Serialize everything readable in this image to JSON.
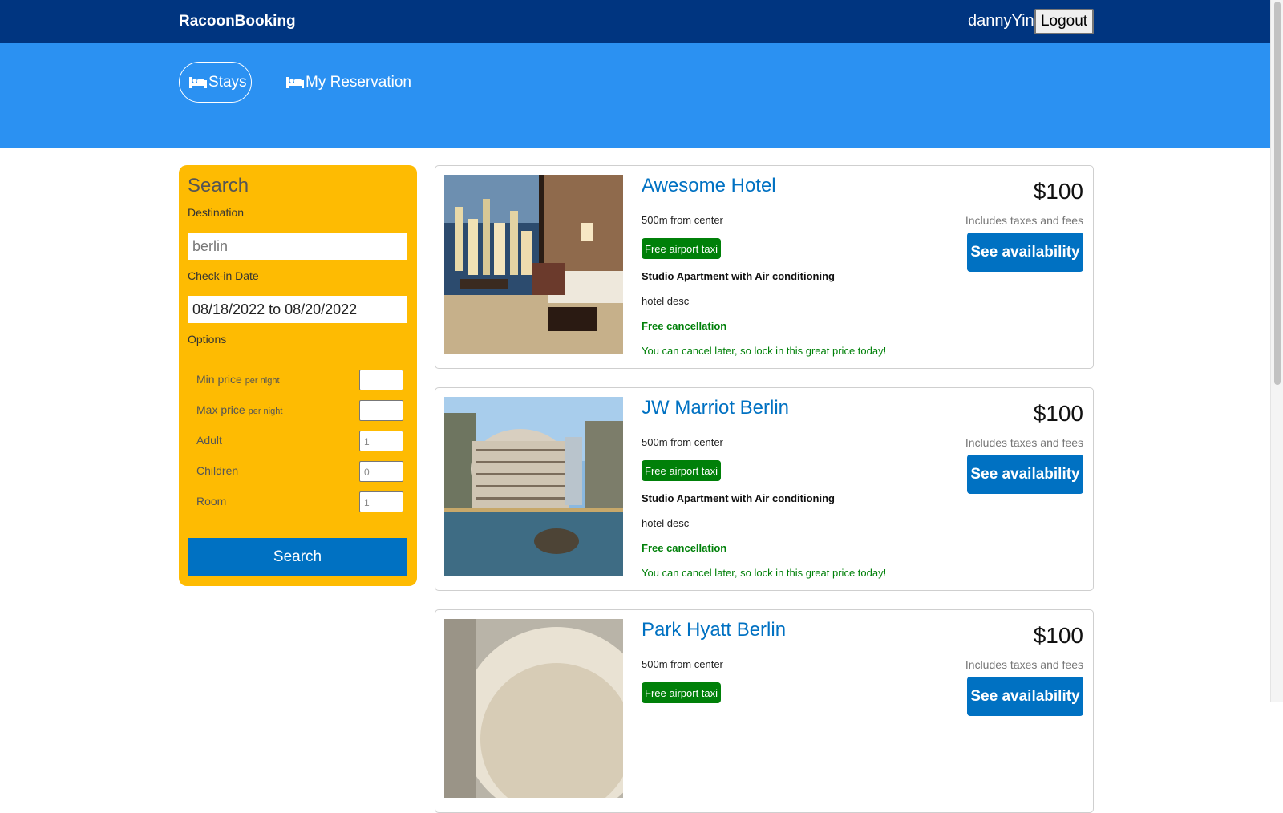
{
  "header": {
    "brand": "RacoonBooking",
    "username": "dannyYin",
    "logout_label": "Logout"
  },
  "nav": {
    "items": [
      {
        "label": "Stays",
        "icon": "bed-icon",
        "active": true
      },
      {
        "label": "My Reservation",
        "icon": "bed-icon",
        "active": false
      }
    ]
  },
  "search": {
    "title": "Search",
    "destination_label": "Destination",
    "destination_placeholder": "berlin",
    "checkin_label": "Check-in Date",
    "checkin_value": "08/18/2022 to 08/20/2022",
    "options_label": "Options",
    "options": [
      {
        "label": "Min price",
        "suffix": "per night",
        "value": ""
      },
      {
        "label": "Max price",
        "suffix": "per night",
        "value": ""
      },
      {
        "label": "Adult",
        "suffix": "",
        "value": "1"
      },
      {
        "label": "Children",
        "suffix": "",
        "value": "0"
      },
      {
        "label": "Room",
        "suffix": "",
        "value": "1"
      }
    ],
    "button_label": "Search"
  },
  "results": [
    {
      "name": "Awesome Hotel",
      "distance": "500m from center",
      "taxi": "Free airport taxi",
      "room": "Studio Apartment with Air conditioning",
      "desc": "hotel desc",
      "cancel": "Free cancellation",
      "cancel_sub": "You can cancel later, so lock in this great price today!",
      "price": "$100",
      "tax_note": "Includes taxes and fees",
      "button": "See availability"
    },
    {
      "name": "JW Marriot Berlin",
      "distance": "500m from center",
      "taxi": "Free airport taxi",
      "room": "Studio Apartment with Air conditioning",
      "desc": "hotel desc",
      "cancel": "Free cancellation",
      "cancel_sub": "You can cancel later, so lock in this great price today!",
      "price": "$100",
      "tax_note": "Includes taxes and fees",
      "button": "See availability"
    },
    {
      "name": "Park Hyatt Berlin",
      "distance": "500m from center",
      "taxi": "Free airport taxi",
      "room": "",
      "desc": "",
      "cancel": "",
      "cancel_sub": "",
      "price": "$100",
      "tax_note": "Includes taxes and fees",
      "button": "See availability"
    }
  ],
  "colors": {
    "header_bg": "#003580",
    "nav_bg": "#2b91f2",
    "search_bg": "#febb02",
    "primary": "#0071c2",
    "green": "#008009"
  }
}
